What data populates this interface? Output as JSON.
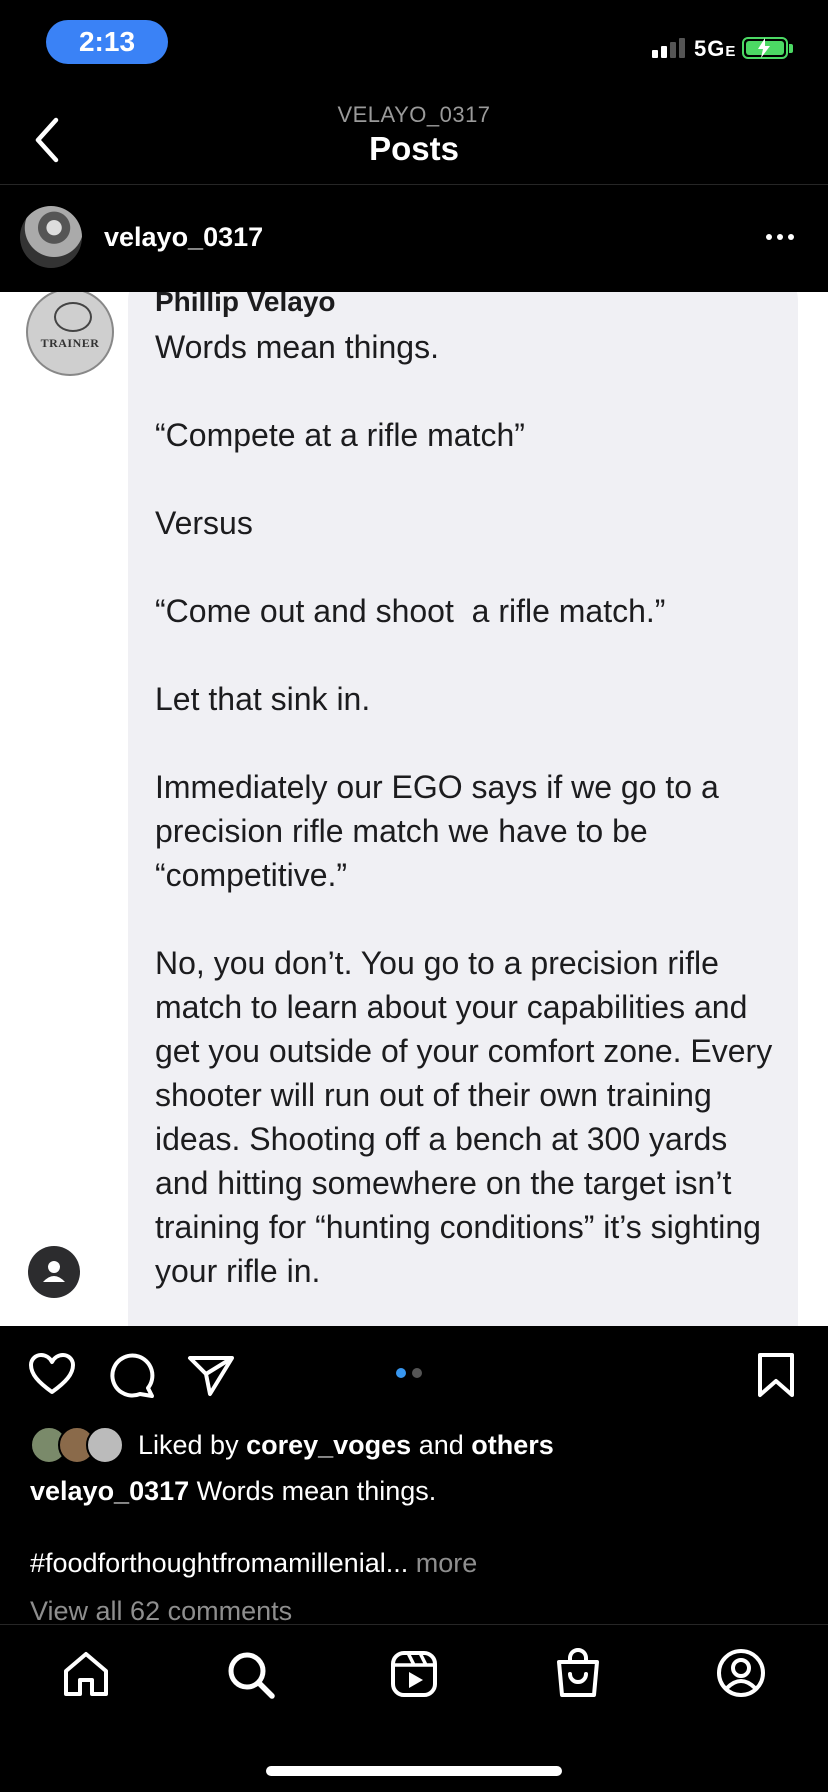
{
  "status_bar": {
    "time": "2:13",
    "network": "5G",
    "network_suffix": "E"
  },
  "nav": {
    "subtitle": "VELAYO_0317",
    "title": "Posts"
  },
  "post_header": {
    "username": "velayo_0317"
  },
  "post_image": {
    "author": "Phillip Velayo",
    "avatar_text": "TRAINER",
    "body": "Words mean things.\n\n“Compete at a rifle match”\n\nVersus\n\n“Come out and shoot  a rifle match.”\n\nLet that sink in.\n\nImmediately our EGO says if we go to a precision rifle match we have to be “competitive.”\n\nNo, you don’t. You go to a precision rifle match to learn about your capabilities and get you outside of your comfort zone. Every shooter will run out of their own training ideas. Shooting off a bench at 300 yards and hitting somewhere on the target isn’t training for “hunting conditions” it’s sighting your rifle in."
  },
  "carousel": {
    "current": 1,
    "total": 2
  },
  "likes": {
    "prefix": "Liked by",
    "user": "corey_voges",
    "and": "and",
    "others": "others"
  },
  "caption": {
    "username": "velayo_0317",
    "text": "Words mean things."
  },
  "hashtag": {
    "text": "#foodforthoughtfromamillenial...",
    "more": "more"
  },
  "comments_link": "View all 62 comments",
  "colors": {
    "accent_blue": "#3897f0",
    "time_pill": "#3a82f6",
    "battery": "#4cd964"
  },
  "icons": [
    "back-chevron-icon",
    "more-options-icon",
    "heart-icon",
    "comment-icon",
    "share-icon",
    "bookmark-icon",
    "home-icon",
    "search-icon",
    "reels-icon",
    "shop-icon",
    "profile-icon"
  ]
}
